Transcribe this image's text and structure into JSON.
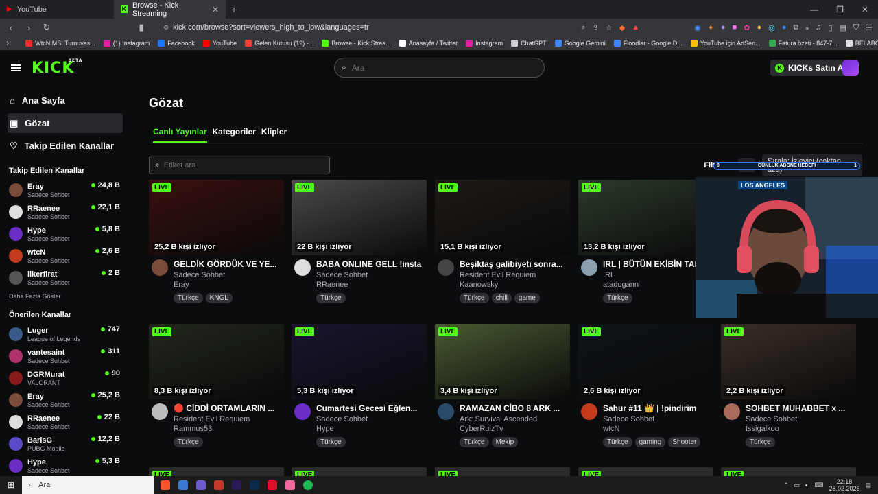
{
  "browser": {
    "tabs": [
      {
        "label": "YouTube",
        "active": false
      },
      {
        "label": "Browse - Kick Streaming",
        "active": true
      }
    ],
    "url": "kick.com/browse?sort=viewers_high_to_low&languages=tr",
    "bookmarks": [
      {
        "label": "WtcN MSI Turnuvas...",
        "color": "#e5322d"
      },
      {
        "label": "(1) Instagram",
        "color": "#d6249f"
      },
      {
        "label": "Facebook",
        "color": "#1877f2"
      },
      {
        "label": "YouTube",
        "color": "#ff0000"
      },
      {
        "label": "Gelen Kutusu (19) -...",
        "color": "#ea4335"
      },
      {
        "label": "Browse - Kick Strea...",
        "color": "#53fc18"
      },
      {
        "label": "Anasayfa / Twitter",
        "color": "#ffffff"
      },
      {
        "label": "Instagram",
        "color": "#d6249f"
      },
      {
        "label": "ChatGPT",
        "color": "#cccccc"
      },
      {
        "label": "Google Gemini",
        "color": "#4285f4"
      },
      {
        "label": "Floodlar - Google D...",
        "color": "#4285f4"
      },
      {
        "label": "YouTube için AdSen...",
        "color": "#fbbc05"
      },
      {
        "label": "Fatura özeti - 847-7...",
        "color": "#34a853"
      },
      {
        "label": "BELABOX cloud",
        "color": "#dddddd"
      }
    ]
  },
  "header": {
    "logo": "KICK",
    "logo_badge": "BETA",
    "search_placeholder": "Ara",
    "kicks_button": "KICKs Satın Al"
  },
  "sidebar": {
    "nav": [
      {
        "label": "Ana Sayfa",
        "icon": "home-icon",
        "active": false
      },
      {
        "label": "Gözat",
        "icon": "browse-icon",
        "active": true
      },
      {
        "label": "Takip Edilen Kanallar",
        "icon": "heart-icon",
        "active": false
      }
    ],
    "followed_title": "Takip Edilen Kanallar",
    "followed": [
      {
        "name": "Eray",
        "category": "Sadece Sohbet",
        "viewers": "24,8 B",
        "color": "#7a4b3a"
      },
      {
        "name": "RRaenee",
        "category": "Sadece Sohbet",
        "viewers": "22,1 B",
        "color": "#dddddd"
      },
      {
        "name": "Hype",
        "category": "Sadece Sohbet",
        "viewers": "5,8 B",
        "color": "#6a2ec7"
      },
      {
        "name": "wtcN",
        "category": "Sadece Sohbet",
        "viewers": "2,6 B",
        "color": "#c43a1d"
      },
      {
        "name": "ilkerfirat",
        "category": "Sadece Sohbet",
        "viewers": "2 B",
        "color": "#555555"
      }
    ],
    "show_more": "Daha Fazla Göster",
    "recommended_title": "Önerilen Kanallar",
    "recommended": [
      {
        "name": "Luger",
        "category": "League of Legends",
        "viewers": "747",
        "color": "#3a5a8a"
      },
      {
        "name": "vantesaint",
        "category": "Sadece Sohbet",
        "viewers": "311",
        "color": "#b0306a"
      },
      {
        "name": "DGRMurat",
        "category": "VALORANT",
        "viewers": "90",
        "color": "#8a1a1a"
      },
      {
        "name": "Eray",
        "category": "Sadece Sohbet",
        "viewers": "25,2 B",
        "color": "#7a4b3a"
      },
      {
        "name": "RRaenee",
        "category": "Sadece Sohbet",
        "viewers": "22 B",
        "color": "#dddddd"
      },
      {
        "name": "BarisG",
        "category": "PUBG Mobile",
        "viewers": "12,2 B",
        "color": "#5a4ac7"
      },
      {
        "name": "Hype",
        "category": "Sadece Sohbet",
        "viewers": "5,3 B",
        "color": "#6a2ec7"
      }
    ]
  },
  "main": {
    "title": "Gözat",
    "tabs": [
      "Canlı Yayınlar",
      "Kategoriler",
      "Klipler"
    ],
    "tag_placeholder": "Etiket ara",
    "filter_label": "Filtrele:",
    "language_select": "Dil",
    "sort_select": "Sırala: İzleyici (çoktan aza)",
    "live_badge": "LIVE",
    "streams": [
      {
        "views": "25,2 B kişi izliyor",
        "title": "GELDİK GÖRDÜK VE YE...",
        "category": "Sadece Sohbet",
        "channel": "Eray",
        "tags": [
          "Türkçe",
          "KNGL"
        ],
        "thumb": "#3a1010",
        "pic": "#7a4b3a"
      },
      {
        "views": "22 B kişi izliyor",
        "title": "BABA ONLINE GELL !insta",
        "category": "Sadece Sohbet",
        "channel": "RRaenee",
        "tags": [
          "Türkçe"
        ],
        "thumb": "#4a4a4a",
        "pic": "#dddddd"
      },
      {
        "views": "15,1 B kişi izliyor",
        "title": "Beşiktaş galibiyeti sonra...",
        "category": "Resident Evil Requiem",
        "channel": "Kaanowsky",
        "tags": [
          "Türkçe",
          "chill",
          "game"
        ],
        "thumb": "#1e1a16",
        "pic": "#444444"
      },
      {
        "views": "13,2 B kişi izliyor",
        "title": "IRL | BÜTÜN EKİBİN TAR",
        "category": "IRL",
        "channel": "atadogann",
        "tags": [
          "Türkçe"
        ],
        "thumb": "#2c3a2a",
        "pic": "#8aa0b0"
      },
      {
        "views": "8,3 B kişi izliyor",
        "title": "🔴 CİDDİ ORTAMLARIN ...",
        "category": "Resident Evil Requiem",
        "channel": "Rammus53",
        "tags": [
          "Türkçe"
        ],
        "thumb": "#22271d",
        "pic": "#bbbbbb"
      },
      {
        "views": "5,3 B kişi izliyor",
        "title": "Cumartesi Gecesi Eğlen...",
        "category": "Sadece Sohbet",
        "channel": "Hype",
        "tags": [
          "Türkçe"
        ],
        "thumb": "#1b1530",
        "pic": "#6a2ec7"
      },
      {
        "views": "3,4 B kişi izliyor",
        "title": "RAMAZAN CİBO 8 ARK ...",
        "category": "Ark: Survival Ascended",
        "channel": "CyberRulzTv",
        "tags": [
          "Türkçe",
          "Mekip"
        ],
        "thumb": "#4a5a32",
        "pic": "#2a4a6a"
      },
      {
        "views": "2,6 B kişi izliyor",
        "title": "Sahur #11 👑 | !pindirim",
        "category": "Sadece Sohbet",
        "channel": "wtcN",
        "tags": [
          "Türkçe",
          "gaming",
          "Shooter"
        ],
        "thumb": "#101418",
        "pic": "#c43a1d"
      },
      {
        "views": "2,2 B kişi izliyor",
        "title": "SOHBET MUHABBET x ...",
        "category": "Sadece Sohbet",
        "channel": "tssigalkoo",
        "tags": [
          "Türkçe"
        ],
        "thumb": "#3a2f28",
        "pic": "#a86a5a"
      }
    ]
  },
  "overlay": {
    "goal_text": "GÜNLÜK ABONE HEDEFİ",
    "goal_left": "0",
    "goal_right": "1",
    "sign_text": "LOS ANGELES"
  },
  "taskbar": {
    "search": "Ara",
    "time": "22:18",
    "date": "28.02.2026"
  }
}
